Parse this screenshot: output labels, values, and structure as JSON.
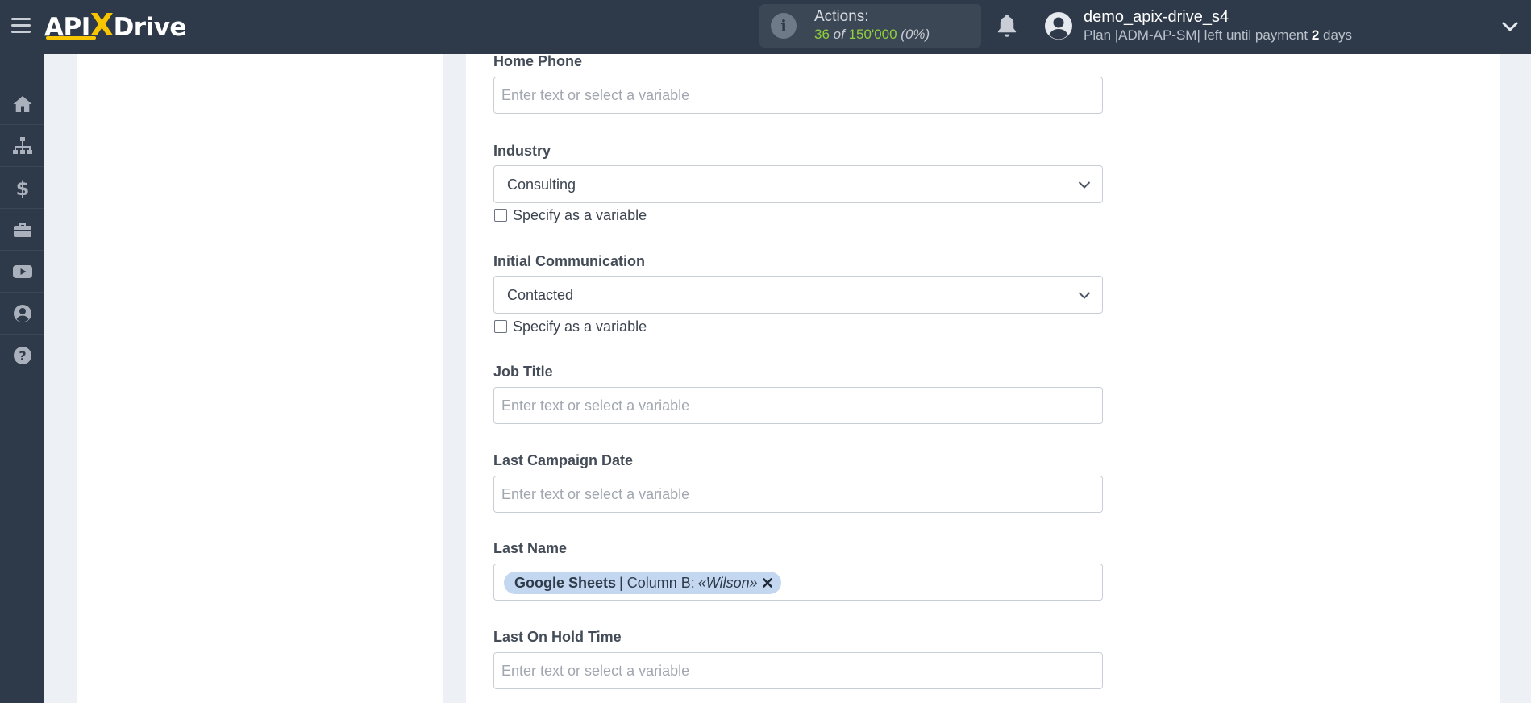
{
  "header": {
    "logo": {
      "prefix": "API",
      "x": "X",
      "suffix": "Drive"
    },
    "actions": {
      "label": "Actions:",
      "used": "36",
      "of": "of",
      "total": "150'000",
      "percent": "(0%)"
    },
    "user": {
      "name": "demo_apix-drive_s4",
      "plan_prefix": "Plan |ADM-AP-SM| left until payment",
      "days_count": "2",
      "days_suffix": "days"
    }
  },
  "sidebar": {
    "items": [
      {
        "icon": "home-icon"
      },
      {
        "icon": "sitemap-icon"
      },
      {
        "icon": "dollar-icon"
      },
      {
        "icon": "briefcase-icon"
      },
      {
        "icon": "youtube-icon"
      },
      {
        "icon": "user-circle-icon"
      },
      {
        "icon": "help-icon"
      }
    ]
  },
  "form": {
    "home_phone": {
      "label": "Home Phone",
      "placeholder": "Enter text or select a variable"
    },
    "industry": {
      "label": "Industry",
      "value": "Consulting",
      "checkbox": "Specify as a variable"
    },
    "initial_communication": {
      "label": "Initial Communication",
      "value": "Contacted",
      "checkbox": "Specify as a variable"
    },
    "job_title": {
      "label": "Job Title",
      "placeholder": "Enter text or select a variable"
    },
    "last_campaign_date": {
      "label": "Last Campaign Date",
      "placeholder": "Enter text or select a variable"
    },
    "last_name": {
      "label": "Last Name",
      "tag": {
        "source": "Google Sheets",
        "separator": "| Column B:",
        "value": "«Wilson»"
      }
    },
    "last_on_hold_time": {
      "label": "Last On Hold Time",
      "placeholder": "Enter text or select a variable"
    }
  },
  "colors": {
    "topbar": "#2e3a49",
    "accent": "#f7c600",
    "count": "#8fcf3c",
    "tag": "#c3d8f0"
  }
}
